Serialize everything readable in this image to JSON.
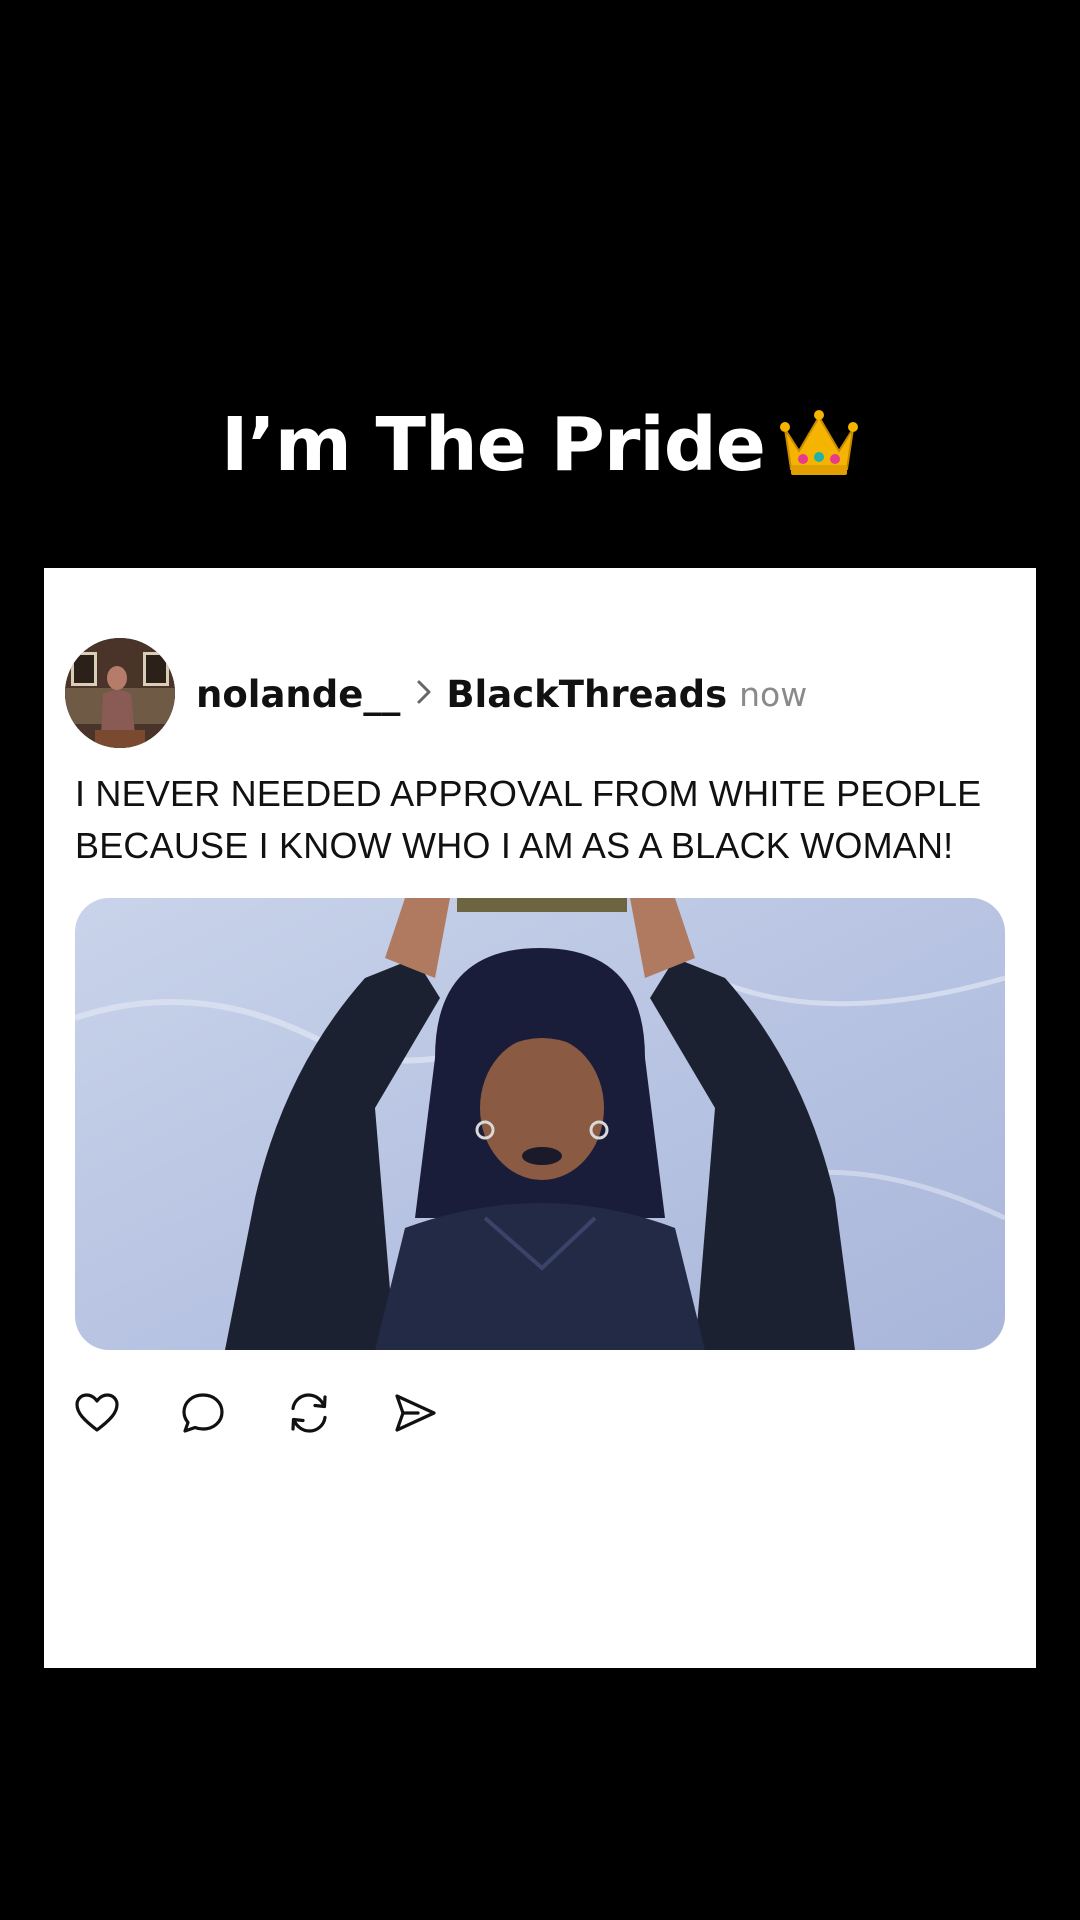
{
  "overlay": {
    "title": "I’m The Pride",
    "title_emoji_icon": "crown-icon"
  },
  "post": {
    "username": "nolande__",
    "separator_icon": "chevron-right-icon",
    "community": "BlackThreads",
    "timestamp": "now",
    "text": "I NEVER NEEDED APPROVAL FROM WHITE PEOPLE BECAUSE I KNOW WHO I AM AS A BLACK WOMAN!",
    "media_description_icon": "photo-image",
    "actions": [
      {
        "name": "like",
        "icon": "heart-icon"
      },
      {
        "name": "comment",
        "icon": "speech-bubble-icon"
      },
      {
        "name": "repost",
        "icon": "repost-arrows-icon"
      },
      {
        "name": "share",
        "icon": "paper-plane-icon"
      }
    ]
  },
  "colors": {
    "background": "#000000",
    "card": "#ffffff",
    "text_primary": "#111111",
    "text_secondary": "#8a8a8a"
  }
}
